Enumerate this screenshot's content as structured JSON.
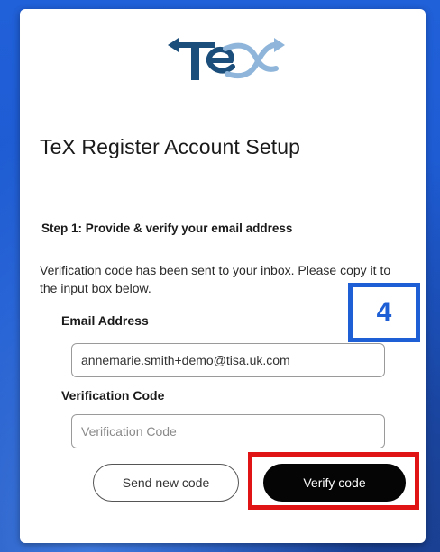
{
  "brand": {
    "logo_text": "TeX",
    "colors": {
      "dark": "#1b4e7a",
      "light": "#8fb6da"
    }
  },
  "form": {
    "title": "TeX Register Account Setup",
    "step_heading": "Step 1: Provide & verify your email address",
    "intro": "Verification code has been sent to your inbox. Please copy it to the input box below.",
    "email": {
      "label": "Email Address",
      "value": "annemarie.smith+demo@tisa.uk.com"
    },
    "code": {
      "label": "Verification Code",
      "placeholder": "Verification Code",
      "value": ""
    },
    "buttons": {
      "send_new_code": "Send new code",
      "verify_code": "Verify code"
    }
  },
  "annotations": {
    "step_badge": "4",
    "highlight_color": "#e01414",
    "badge_color": "#1f5fd6"
  }
}
